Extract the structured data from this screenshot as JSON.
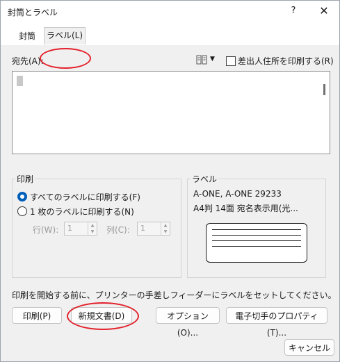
{
  "window": {
    "title": "封筒とラベル",
    "help_glyph": "?",
    "close_glyph": "✕"
  },
  "tabs": [
    {
      "label": "封筒"
    },
    {
      "label": "ラベル(L)"
    }
  ],
  "address": {
    "label": "宛先(A):",
    "value": "",
    "omit_sender_label": "差出人住所を印刷する(R)",
    "omit_sender_checked": false
  },
  "print_group": {
    "title": "印刷",
    "full_page_label": "すべてのラベルに印刷する(F)",
    "single_label": "1 枚のラベルに印刷する(N)",
    "row_label": "行(W):",
    "row_value": "1",
    "col_label": "列(C):",
    "col_value": "1"
  },
  "label_group": {
    "title": "ラベル",
    "line1": "A-ONE, A-ONE 29233",
    "line2": "A4判 14面 宛名表示用(光..."
  },
  "instruction": "印刷を開始する前に、プリンターの手差しフィーダーにラベルをセットしてください。",
  "buttons": {
    "print": "印刷(P)",
    "new_document": "新規文書(D)",
    "options": "オプション(O)...",
    "epostage": "電子切手のプロパティ(T)...",
    "cancel": "キャンセル"
  },
  "colors": {
    "highlight_oval": "#e3202a",
    "radio_accent": "#005fb8"
  }
}
